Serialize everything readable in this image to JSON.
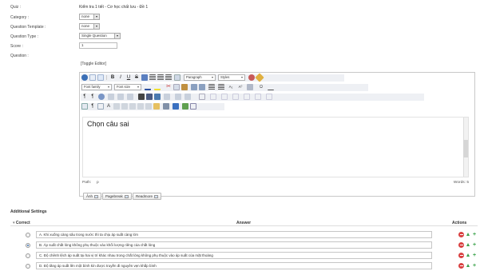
{
  "form": {
    "quiz_label": "Quiz :",
    "quiz_value": "Kiểm tra 1 tiết - Cơ học chất lưu - Đề 1",
    "category_label": "Category :",
    "category_value": "none",
    "template_label": "Question Template :",
    "template_value": "none",
    "type_label": "Question Type :",
    "type_value": "Single Question",
    "score_label": "Score :",
    "score_value": "1",
    "question_label": "Question :",
    "toggle_editor": "[Toggle Editor]"
  },
  "editor": {
    "font_family": "Font family",
    "font_size": "Font size",
    "paragraph": "Paragraph",
    "styles": "Styles",
    "content": "Chọn câu sai",
    "path_label": "Path:",
    "path_value": "p",
    "words": "Words: 5"
  },
  "buttons": {
    "anh": "Ảnh",
    "pagebreak": "Pagebreak",
    "readmore": "Readmore"
  },
  "additional": {
    "title": "Additional Settings",
    "col_correct": "Correct",
    "col_answer": "Answer",
    "col_actions": "Actions",
    "answers": [
      {
        "text": "A. Khi xuống càng sâu trong nước thì ta chịu áp suất càng lớn",
        "selected": false
      },
      {
        "text": "B. Áp suất chất lỏng không phụ thuộc vào khối lượng riêng của chất lỏng",
        "selected": true
      },
      {
        "text": "C. Độ chênh lệch áp suất tại hai vị trí khác nhau trong chất lỏng không phụ thuộc vào áp suất của mặt thoáng",
        "selected": false
      },
      {
        "text": "D. Độ tăng áp suất lên một bình kín được truyền đi nguyên vẹn khắp bình",
        "selected": false
      }
    ]
  },
  "colors": {
    "accent_blue": "#3a6fb0",
    "delete_red": "#d94242",
    "add_green": "#3aa34a"
  }
}
